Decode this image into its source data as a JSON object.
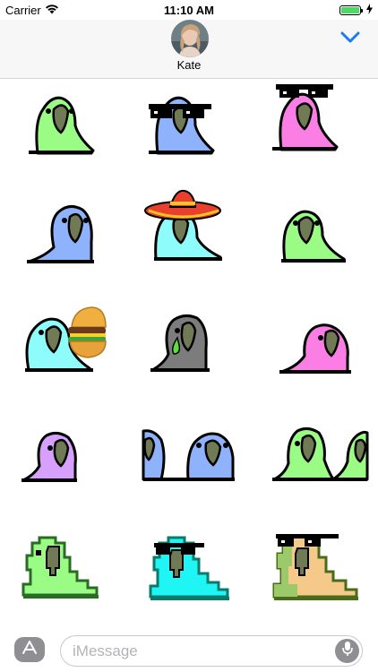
{
  "status_bar": {
    "carrier": "Carrier",
    "time": "11:10 AM",
    "battery_level": 1.0
  },
  "header": {
    "contact_name": "Kate"
  },
  "message_input": {
    "placeholder": "iMessage"
  },
  "icons": {
    "app_store": "app-store-icon",
    "microphone": "microphone-icon",
    "collapse": "chevron-down-icon",
    "wifi": "wifi-icon",
    "charging": "charging-bolt-icon"
  },
  "colors": {
    "accent": "#1a7cf4",
    "parrot_green": "#9afc85",
    "parrot_blue": "#8fb2fc",
    "parrot_pink": "#fa7ee4",
    "parrot_cyan": "#8ffcfc",
    "parrot_purple": "#d6a0fc",
    "parrot_gray": "#7c7c7c"
  },
  "stickers": [
    {
      "name": "green-parrot",
      "color": "#9afc85",
      "accessory": "none"
    },
    {
      "name": "blue-parrot-with-sunglasses",
      "color": "#8fb2fc",
      "accessory": "sunglasses"
    },
    {
      "name": "pink-parrot-with-sunglasses",
      "color": "#fa7ee4",
      "accessory": "sunglasses"
    },
    {
      "name": "blue-parrot",
      "color": "#8fb2fc",
      "accessory": "none"
    },
    {
      "name": "cyan-parrot-with-sombrero",
      "color": "#8ffcfc",
      "accessory": "sombrero"
    },
    {
      "name": "green-parrot-2",
      "color": "#9afc85",
      "accessory": "none"
    },
    {
      "name": "cyan-parrot-with-burger",
      "color": "#8ffcfc",
      "accessory": "burger"
    },
    {
      "name": "sad-gray-parrot",
      "color": "#7c7c7c",
      "accessory": "tear"
    },
    {
      "name": "pink-parrot-flat",
      "color": "#fa7ee4",
      "accessory": "none"
    },
    {
      "name": "purple-parrot",
      "color": "#d6a0fc",
      "accessory": "none"
    },
    {
      "name": "blue-parrot-pair",
      "color": "#8fb2fc",
      "accessory": "pair"
    },
    {
      "name": "green-parrot-pair",
      "color": "#9afc85",
      "accessory": "pair"
    },
    {
      "name": "pixel-green-parrot",
      "color": "#9afc85",
      "accessory": "pixel"
    },
    {
      "name": "pixel-cyan-parrot-with-sunglasses",
      "color": "#1ff5f5",
      "accessory": "pixel-sunglasses"
    },
    {
      "name": "pixel-tan-parrot-with-sunglasses",
      "color": "#f5c98a",
      "accessory": "pixel-sunglasses"
    }
  ]
}
